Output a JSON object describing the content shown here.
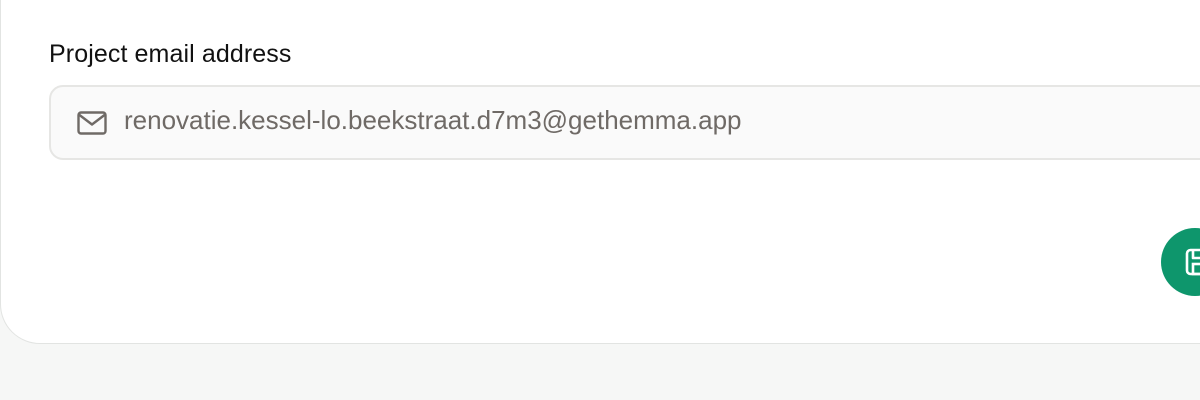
{
  "form": {
    "email_label": "Project email address",
    "email_value": "renovatie.kessel-lo.beekstraat.d7m3@gethemma.app",
    "email_icon": "mail-icon"
  },
  "actions": {
    "save_icon": "save-icon",
    "save_color": "#0e966c"
  },
  "colors": {
    "page_background": "#f6f7f6",
    "card_background": "#ffffff",
    "input_background": "#fafafa",
    "value_text": "#6f6a66"
  }
}
